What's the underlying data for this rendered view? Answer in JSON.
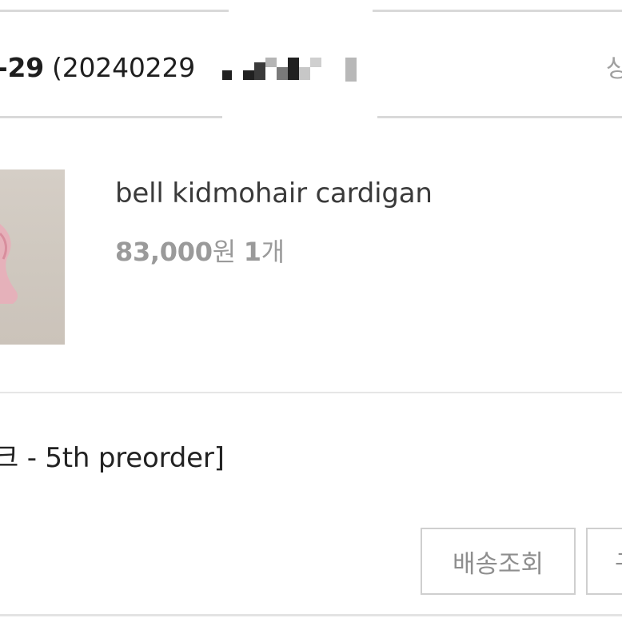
{
  "order": {
    "date_fragment": "-29",
    "number_fragment": "(20240229",
    "status_fragment": "상"
  },
  "product": {
    "name": "bell kidmohair cardigan",
    "price": "83,000",
    "price_unit": "원",
    "quantity": "1",
    "quantity_unit": "개",
    "thumbnail_icon": "product-thumbnail-image"
  },
  "option": {
    "text": "크 - 5th preorder]"
  },
  "actions": {
    "tracking_label": "배송조회",
    "second_label_fragment": "구"
  },
  "colors": {
    "divider": "#d9d9d9",
    "muted_text": "#9a9a9a",
    "button_border": "#cfcfcf"
  }
}
